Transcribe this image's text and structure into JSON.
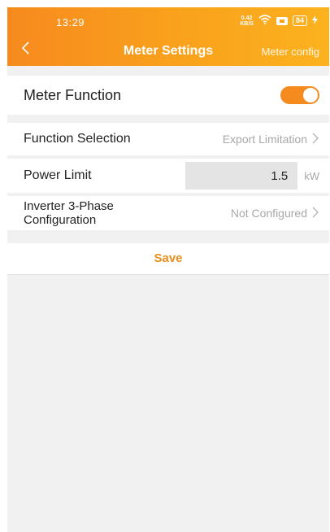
{
  "status_bar": {
    "time": "13:29",
    "net_speed_top": "0.42",
    "net_speed_bottom": "KB/S",
    "battery": "84"
  },
  "header": {
    "title": "Meter Settings",
    "right_link": "Meter config"
  },
  "meter_function": {
    "label": "Meter Function",
    "enabled": true
  },
  "function_selection": {
    "label": "Function Selection",
    "value": "Export Limitation"
  },
  "power_limit": {
    "label": "Power Limit",
    "value": "1.5",
    "unit": "kW"
  },
  "inverter_config": {
    "label": "Inverter 3-Phase Configuration",
    "value": "Not Configured"
  },
  "save_label": "Save",
  "colors": {
    "accent": "#f58a1f",
    "header_start": "#f78a1e",
    "header_end": "#fcb21f",
    "save_text": "#e8901e"
  }
}
